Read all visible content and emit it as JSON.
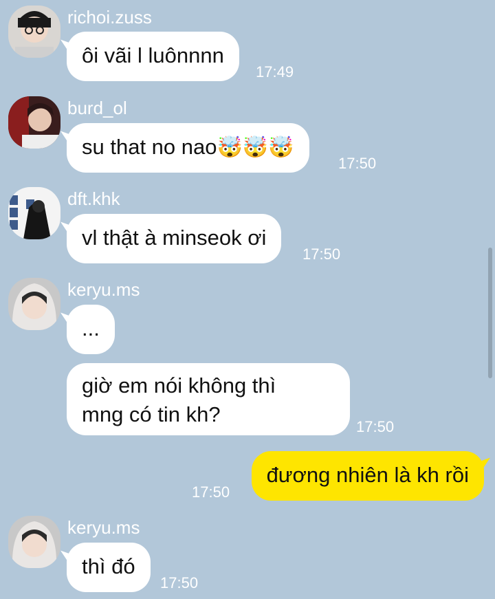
{
  "messages": [
    {
      "sender": "richoi.zuss",
      "text": "ôi vãi l luônnnn",
      "time": "17:49"
    },
    {
      "sender": "burd_ol",
      "text": "su that no nao",
      "emoji": "🤯🤯🤯",
      "time": "17:50"
    },
    {
      "sender": "dft.khk",
      "text": "vl thật à minseok ơi",
      "time": "17:50"
    },
    {
      "sender": "keryu.ms",
      "text": "...",
      "time": ""
    },
    {
      "sender": "",
      "line1": "giờ em nói không thì",
      "line2": "mng có tin kh?",
      "time": "17:50"
    },
    {
      "sender": "me",
      "text": "đương nhiên là kh rồi",
      "time": "17:50"
    },
    {
      "sender": "keryu.ms",
      "text": "thì đó",
      "time": "17:50"
    }
  ],
  "colors": {
    "background": "#b2c7d9",
    "incoming_bubble": "#ffffff",
    "outgoing_bubble": "#fee500",
    "meta_text": "#ffffff"
  },
  "icons": {
    "avatar": "profile-photo"
  }
}
